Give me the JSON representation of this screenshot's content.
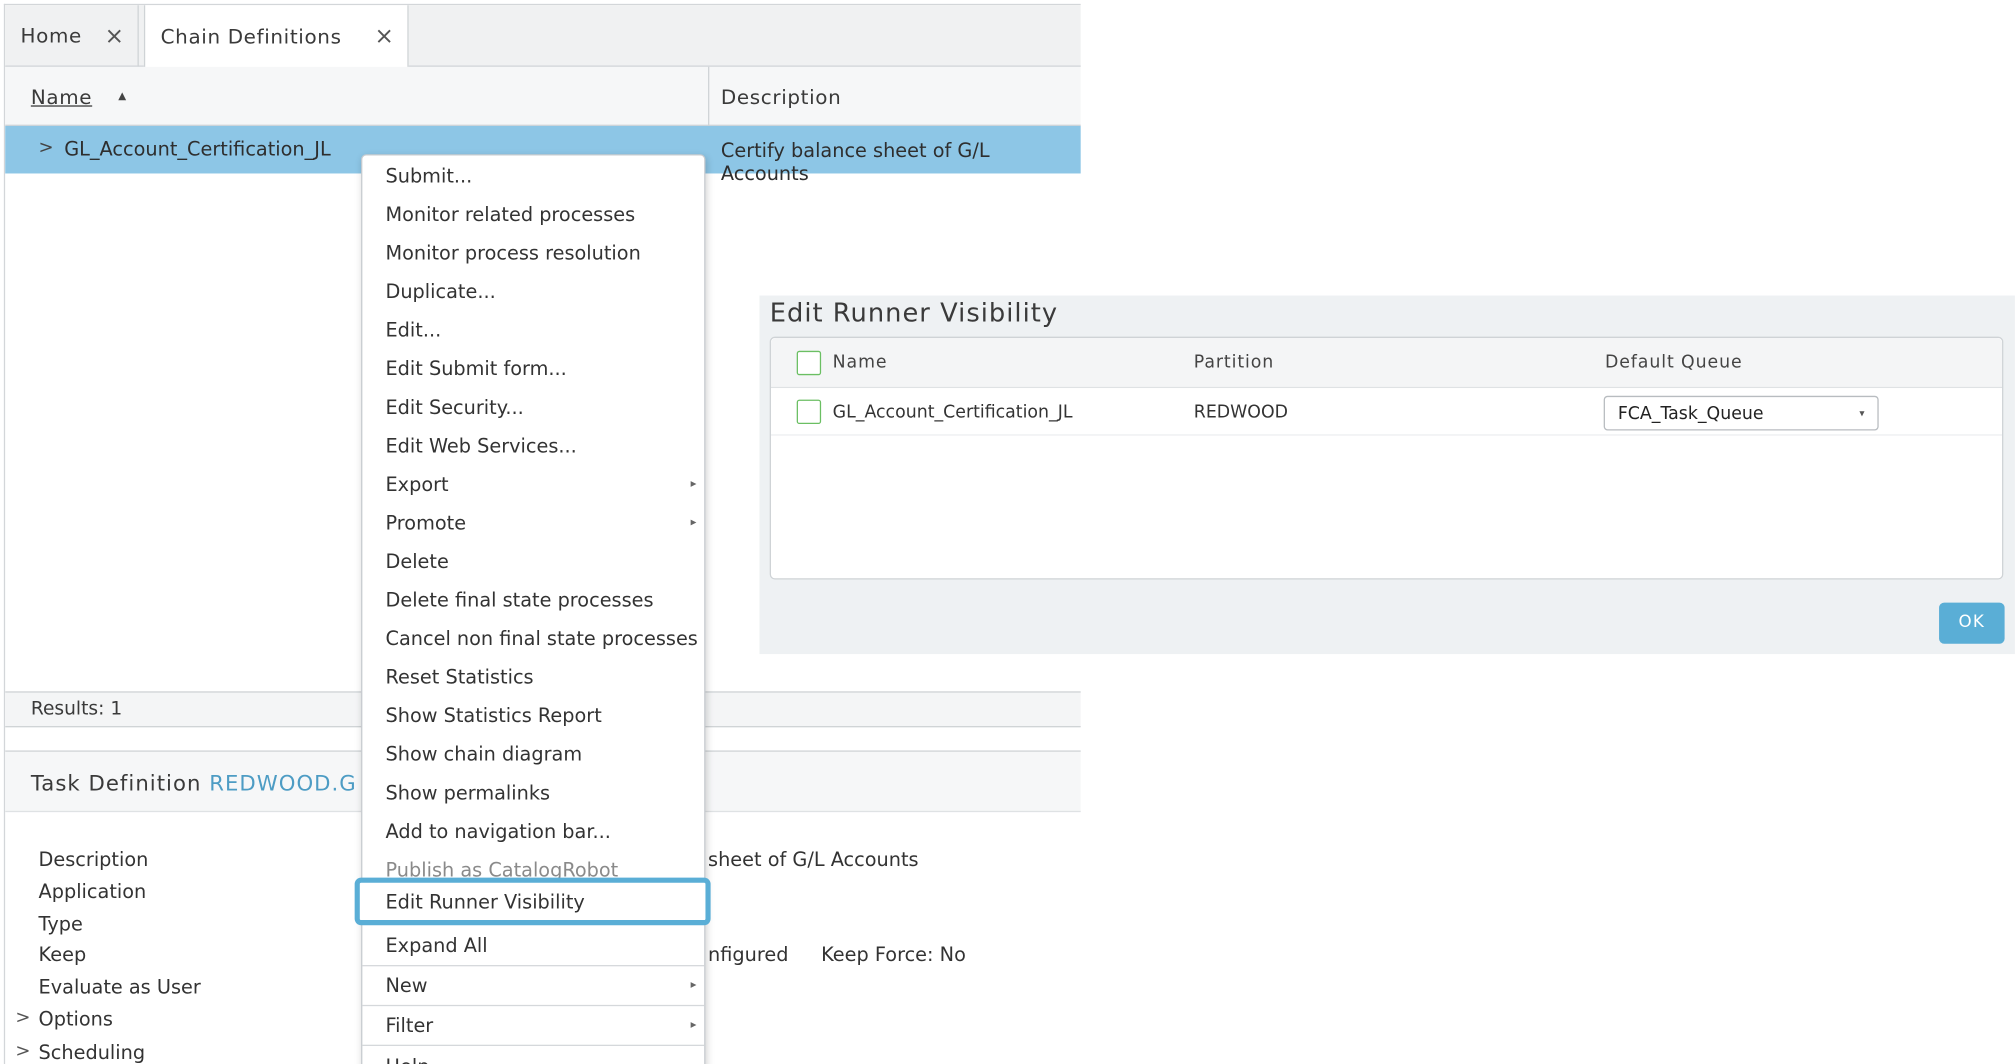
{
  "tabs": [
    {
      "label": "Home",
      "close": "×"
    },
    {
      "label": "Chain Definitions",
      "close": "×"
    }
  ],
  "grid": {
    "col_name": "Name",
    "sort_icon": "▲",
    "col_description": "Description",
    "row": {
      "expander": ">",
      "name": "GL_Account_Certification_JL",
      "description": "Certify balance sheet of G/L Accounts"
    },
    "results": "Results: 1"
  },
  "detail": {
    "title_prefix": "Task Definition ",
    "title_link": "REDWOOD.G",
    "props": [
      {
        "label": "Description",
        "value": "sheet of G/L Accounts"
      },
      {
        "label": "Application",
        "value": ""
      },
      {
        "label": "Type",
        "value": ""
      },
      {
        "label": "Keep",
        "value": "nfigured",
        "extra": "Keep Force: No"
      },
      {
        "label": "Evaluate as User",
        "value": ""
      },
      {
        "label": "Options",
        "value": ""
      },
      {
        "label": "Scheduling",
        "value": ""
      }
    ],
    "expander": ">"
  },
  "menu": {
    "items": [
      "Submit...",
      "Monitor related processes",
      "Monitor process resolution",
      "Duplicate...",
      "Edit...",
      "Edit Submit form...",
      "Edit Security...",
      "Edit Web Services...",
      "Export",
      "Promote",
      "Delete",
      "Delete final state processes",
      "Cancel non final state processes",
      "Reset Statistics",
      "Show Statistics Report",
      "Show chain diagram",
      "Show permalinks",
      "Add to navigation bar...",
      "Publish as CatalogRobot",
      "Edit Runner Visibility",
      "Expand All",
      "New",
      "Filter",
      "Help"
    ],
    "submenu_arrow": "▸"
  },
  "dialog": {
    "title": "Edit Runner Visibility",
    "headers": {
      "name": "Name",
      "partition": "Partition",
      "queue": "Default Queue"
    },
    "row": {
      "name": "GL_Account_Certification_JL",
      "partition": "REDWOOD",
      "queue": "FCA_Task_Queue"
    },
    "dropdown_icon": "▾",
    "ok_label": "OK"
  },
  "colors": {
    "selection": "#8dc6e6",
    "accent": "#5aaed6",
    "checkbox": "#6bbf63",
    "link": "#4d9cc4"
  }
}
